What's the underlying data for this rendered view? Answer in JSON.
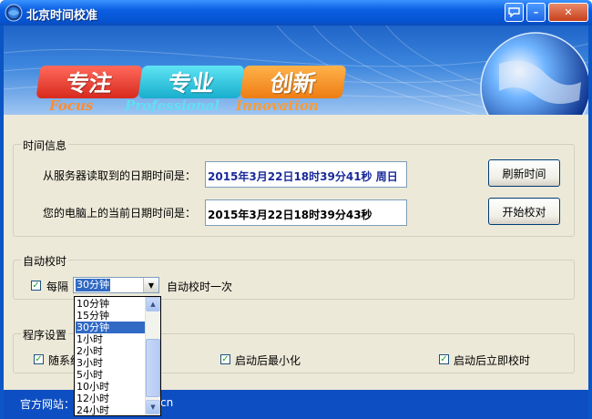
{
  "window": {
    "title": "北京时间校准",
    "help_btn": "?",
    "minimize_btn": "–",
    "close_btn": "✕"
  },
  "banner": {
    "tags": [
      {
        "text": "专注",
        "sub": "Focus"
      },
      {
        "text": "专业",
        "sub": "Professional"
      },
      {
        "text": "创新",
        "sub": "Innovation"
      }
    ]
  },
  "time_info": {
    "group_label": "时间信息",
    "server_label": "从服务器读取到的日期时间是：",
    "server_value": "2015年3月22日18时39分41秒  周日",
    "local_label": "您的电脑上的当前日期时间是：",
    "local_value": "2015年3月22日18时39分43秒",
    "refresh_btn": "刷新时间",
    "calibrate_btn": "开始校对"
  },
  "auto_calibrate": {
    "group_label": "自动校时",
    "checked": true,
    "every_label": "每隔",
    "interval_selected": "30分钟",
    "suffix_label": "自动校时一次",
    "options": [
      "10分钟",
      "15分钟",
      "30分钟",
      "1小时",
      "2小时",
      "3小时",
      "5小时",
      "10小时",
      "12小时",
      "24小时"
    ]
  },
  "program_settings": {
    "group_label": "程序设置",
    "opt1_label": "随系统",
    "opt2_label": "启动后最小化",
    "opt3_label": "启动后立即校时"
  },
  "status": {
    "website_label": "官方网站：",
    "website_tail": "cn"
  },
  "colors": {
    "title_blue": "#0a5ee0",
    "server_text": "#1a2a9a",
    "selection": "#316ac5",
    "check_green": "#21a121"
  }
}
